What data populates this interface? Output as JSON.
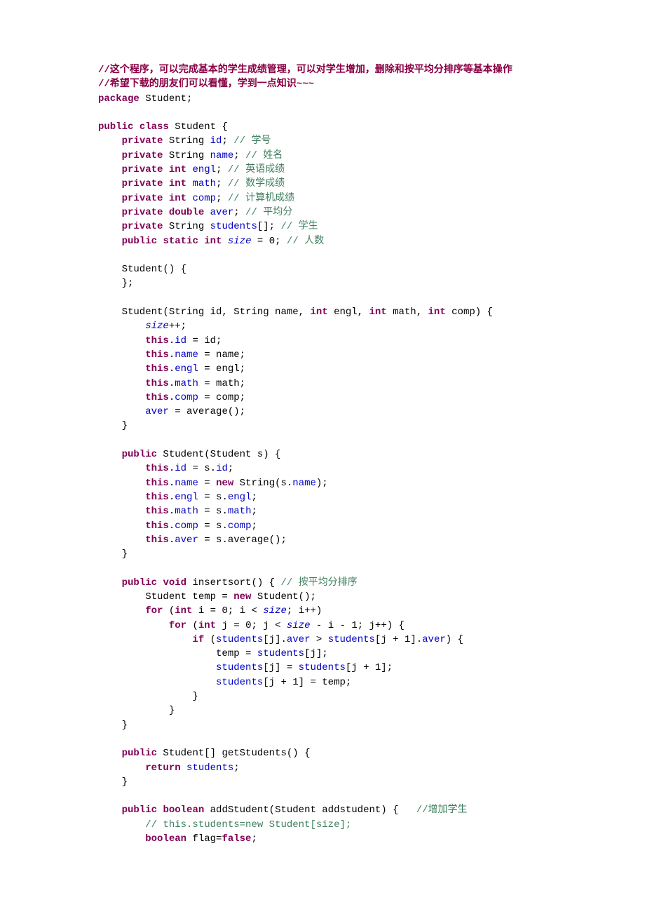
{
  "header": {
    "l1": "//这个程序，可以完成基本的学生成绩管理，可以对学生增加，删除和按平均分排序等基本操作",
    "l2": "//希望下载的朋友们可以看懂，学到一点知识~~~"
  },
  "kw": {
    "package": "package",
    "public": "public",
    "class": "class",
    "private": "private",
    "int": "int",
    "double": "double",
    "static": "static",
    "this": "this",
    "new": "new",
    "void": "void",
    "for": "for",
    "if": "if",
    "return": "return",
    "boolean": "boolean",
    "false": "false"
  },
  "txt": {
    "student_semi": " Student;",
    "student_brace": " Student {",
    "string_id": " String ",
    "id_semi": "; ",
    "name_semi": "; ",
    "engl_semi": "; ",
    "math_semi": "; ",
    "comp_semi": "; ",
    "aver_semi": "; ",
    "students_semi": "[]; ",
    "size_assign": " = 0; ",
    "student_ctor": "    Student() {",
    "close_semi": "    };",
    "ctor2_open": "    Student(String id, String name, ",
    "ctor2_engl": " engl, ",
    "ctor2_math": " math, ",
    "ctor2_comp": " comp) {",
    "size_pp": "++;",
    "dot": ".",
    "assign_id": " = id;",
    "assign_name": " = name;",
    "assign_engl": " = engl;",
    "assign_math": " = math;",
    "assign_comp": " = comp;",
    "aver_avg": " = average();",
    "close": "    }",
    "copy_ctor": " Student(Student s) {",
    "s_id": " = s.",
    "semi": ";",
    "new_str": " String(s.",
    "paren_semi": ");",
    "s_engl": " = s.",
    "s_math": " = s.",
    "s_comp": " = s.",
    "s_avg": " = s.average();",
    "insertsort": " insertsort() { ",
    "temp_new": "        Student temp = ",
    "student_call": " Student();",
    "for_i": " i = 0; i < ",
    "for_i_end": "; i++)",
    "for_j": " j = 0; j < ",
    "for_j_end": " - i - 1; j++) {",
    "if_cond_open": " (",
    "if_j": "[j].",
    "gt": " > ",
    "if_j1": "[j + 1].",
    "if_close": ") {",
    "temp_stu": "                    temp = ",
    "stu_j": "[j];",
    "stu_assign": "[j] = ",
    "stu_j1": "[j + 1];",
    "stu_j1_temp": "[j + 1] = temp;",
    "brace": "                }",
    "brace2": "            }",
    "getstudents": " Student[] getStudents() {",
    "return_stu": " ",
    "addstudent": " addStudent(Student addstudent) {   ",
    "flag_assign": " flag=",
    "indent4": "    ",
    "indent8": "        ",
    "indent12": "            ",
    "indent16": "                ",
    "indent20": "                    ",
    "space": " ",
    "paren_open": " (",
    "assign_new": " = "
  },
  "fld": {
    "id": "id",
    "name": "name",
    "engl": "engl",
    "math": "math",
    "comp": "comp",
    "aver": "aver",
    "students": "students",
    "size": "size"
  },
  "cmt": {
    "id": "// 学号",
    "name": "// 姓名",
    "engl": "// 英语成绩",
    "math": "// 数学成绩",
    "comp": "// 计算机成绩",
    "aver": "// 平均分",
    "students": "// 学生",
    "size": "// 人数",
    "sort": "// 按平均分排序",
    "add": "//增加学生",
    "commented": "// this.students=new Student[size];"
  }
}
